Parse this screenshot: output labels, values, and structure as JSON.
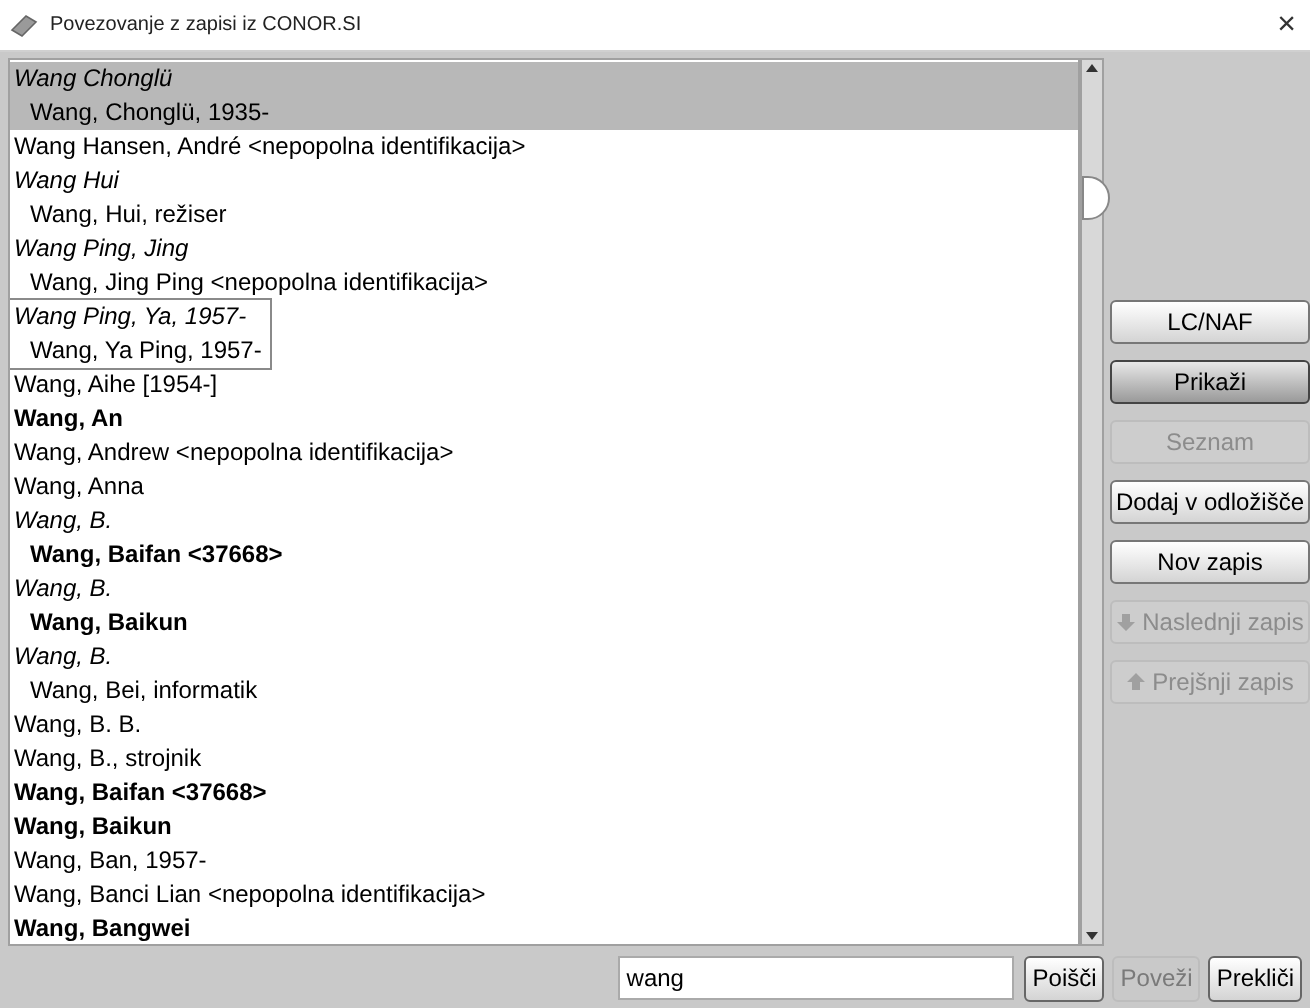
{
  "window": {
    "title": "Povezovanje z zapisi iz CONOR.SI",
    "close": "×"
  },
  "entries": [
    {
      "text": "Wang Chonglü",
      "kind": "italic",
      "selected": true,
      "focused": false,
      "children": [
        {
          "text": "Wang, Chonglü, 1935-",
          "kind": "normal"
        }
      ]
    },
    {
      "text": "Wang Hansen, André <nepopolna identifikacija>",
      "kind": "normal",
      "selected": false,
      "focused": false
    },
    {
      "text": "Wang Hui",
      "kind": "italic",
      "selected": false,
      "focused": false,
      "children": [
        {
          "text": "Wang, Hui, režiser",
          "kind": "normal"
        }
      ]
    },
    {
      "text": "Wang Ping, Jing",
      "kind": "italic",
      "selected": false,
      "focused": false,
      "children": [
        {
          "text": "Wang, Jing Ping <nepopolna identifikacija>",
          "kind": "normal"
        }
      ]
    },
    {
      "text": "Wang Ping, Ya, 1957-",
      "kind": "italic",
      "selected": false,
      "focused": true,
      "children": [
        {
          "text": "Wang, Ya Ping, 1957-",
          "kind": "normal"
        }
      ]
    },
    {
      "text": "Wang, Aihe [1954-]",
      "kind": "normal",
      "selected": false,
      "focused": false
    },
    {
      "text": "Wang, An",
      "kind": "bold",
      "selected": false,
      "focused": false
    },
    {
      "text": "Wang, Andrew <nepopolna identifikacija>",
      "kind": "normal",
      "selected": false,
      "focused": false
    },
    {
      "text": "Wang, Anna",
      "kind": "normal",
      "selected": false,
      "focused": false
    },
    {
      "text": "Wang, B.",
      "kind": "italic",
      "selected": false,
      "focused": false,
      "children": [
        {
          "text": "Wang, Baifan <37668>",
          "kind": "bold"
        }
      ]
    },
    {
      "text": "Wang, B.",
      "kind": "italic",
      "selected": false,
      "focused": false,
      "children": [
        {
          "text": "Wang, Baikun",
          "kind": "bold"
        }
      ]
    },
    {
      "text": "Wang, B.",
      "kind": "italic",
      "selected": false,
      "focused": false,
      "children": [
        {
          "text": "Wang, Bei, informatik",
          "kind": "normal"
        }
      ]
    },
    {
      "text": "Wang, B. B.",
      "kind": "normal",
      "selected": false,
      "focused": false
    },
    {
      "text": "Wang, B., strojnik",
      "kind": "normal",
      "selected": false,
      "focused": false
    },
    {
      "text": "Wang, Baifan <37668>",
      "kind": "bold",
      "selected": false,
      "focused": false
    },
    {
      "text": "Wang, Baikun",
      "kind": "bold",
      "selected": false,
      "focused": false
    },
    {
      "text": "Wang, Ban, 1957-",
      "kind": "normal",
      "selected": false,
      "focused": false
    },
    {
      "text": "Wang, Banci Lian <nepopolna identifikacija>",
      "kind": "normal",
      "selected": false,
      "focused": false
    },
    {
      "text": "Wang, Bangwei",
      "kind": "bold",
      "selected": false,
      "focused": false
    }
  ],
  "side_buttons": [
    {
      "label": "LC/NAF",
      "kind": "plain",
      "disabled": false,
      "default": false
    },
    {
      "label": "Prikaži",
      "kind": "plain",
      "disabled": false,
      "default": true
    },
    {
      "label": "Seznam",
      "kind": "plain",
      "disabled": true,
      "default": false
    },
    {
      "label": "Dodaj v odložišče",
      "kind": "plain",
      "disabled": false,
      "default": false
    },
    {
      "label": "Nov zapis",
      "kind": "plain",
      "disabled": false,
      "default": false
    },
    {
      "label": "Naslednji zapis",
      "kind": "next",
      "disabled": true,
      "default": false
    },
    {
      "label": "Prejšnji zapis",
      "kind": "previous",
      "disabled": true,
      "default": false
    }
  ],
  "search": {
    "value": "wang"
  },
  "bottom_buttons": [
    {
      "label": "Poišči",
      "disabled": false
    },
    {
      "label": "Poveži",
      "disabled": true
    },
    {
      "label": "Prekliči",
      "disabled": false
    }
  ]
}
